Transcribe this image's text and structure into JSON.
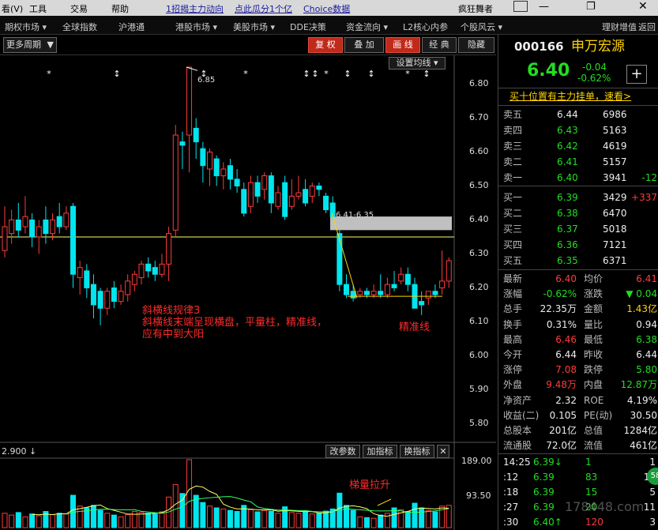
{
  "menubar": {
    "items": [
      "看(V)",
      "工具",
      "交易",
      "帮助",
      "1招揭主力动向",
      "点此瓜分1个亿",
      "Choice数据",
      "疯狂舞者"
    ],
    "window_icons": [
      "mail-icon",
      "minimize-icon",
      "restore-icon",
      "close-icon"
    ]
  },
  "navbar": {
    "items": [
      "期权市场 ▾",
      "全球指数",
      "沪港通",
      "港股市场 ▾",
      "美股市场 ▾",
      "DDE决策",
      "资金流向 ▾",
      "L2核心内参",
      "个股风云 ▾",
      "理财增值",
      "返回"
    ]
  },
  "charttools": {
    "period": "更多周期",
    "fq": "复 权",
    "overlay": "叠 加",
    "line": "画 线",
    "classic": "经 典",
    "hide": "隐藏"
  },
  "chart": {
    "ma_setting": "设置均线",
    "high_label": "6.85",
    "range_label": "6.41-6.35",
    "price_ticks": [
      "6.80",
      "6.70",
      "6.60",
      "6.50",
      "6.40",
      "6.30",
      "6.20",
      "6.10",
      "6.00",
      "5.90",
      "5.80"
    ],
    "annotation_lines": [
      "斜横线规律3",
      "斜横线末端呈现横盘，平量柱，精准线，",
      "应有中到大阳"
    ],
    "precise_label": "精准线",
    "volume_label": "梯量拉升",
    "vol_ticks": [
      "189.00",
      "93.50"
    ],
    "vol_readout": "2.900",
    "vol_buttons": [
      "改参数",
      "加指标",
      "换指标"
    ],
    "candles": [
      {
        "o": 6.31,
        "c": 6.38,
        "h": 6.44,
        "l": 6.29
      },
      {
        "o": 6.36,
        "c": 6.4,
        "h": 6.43,
        "l": 6.33
      },
      {
        "o": 6.4,
        "c": 6.37,
        "h": 6.45,
        "l": 6.35
      },
      {
        "o": 6.38,
        "c": 6.41,
        "h": 6.47,
        "l": 6.36
      },
      {
        "o": 6.4,
        "c": 6.35,
        "h": 6.42,
        "l": 6.32
      },
      {
        "o": 6.35,
        "c": 6.38,
        "h": 6.4,
        "l": 6.3
      },
      {
        "o": 6.4,
        "c": 6.36,
        "h": 6.44,
        "l": 6.33
      },
      {
        "o": 6.36,
        "c": 6.4,
        "h": 6.42,
        "l": 6.34
      },
      {
        "o": 6.41,
        "c": 6.38,
        "h": 6.45,
        "l": 6.36
      },
      {
        "o": 6.38,
        "c": 6.42,
        "h": 6.44,
        "l": 6.37
      },
      {
        "o": 6.44,
        "c": 6.24,
        "h": 6.45,
        "l": 6.2
      },
      {
        "o": 6.23,
        "c": 6.26,
        "h": 6.28,
        "l": 6.18
      },
      {
        "o": 6.25,
        "c": 6.2,
        "h": 6.27,
        "l": 6.17
      },
      {
        "o": 6.21,
        "c": 6.15,
        "h": 6.24,
        "l": 6.11
      },
      {
        "o": 6.19,
        "c": 6.14,
        "h": 6.2,
        "l": 6.09
      },
      {
        "o": 6.14,
        "c": 6.19,
        "h": 6.2,
        "l": 6.12
      },
      {
        "o": 6.2,
        "c": 6.16,
        "h": 6.22,
        "l": 6.14
      },
      {
        "o": 6.16,
        "c": 6.19,
        "h": 6.21,
        "l": 6.15
      },
      {
        "o": 6.18,
        "c": 6.22,
        "h": 6.24,
        "l": 6.16
      },
      {
        "o": 6.21,
        "c": 6.24,
        "h": 6.25,
        "l": 6.19
      },
      {
        "o": 6.23,
        "c": 6.27,
        "h": 6.28,
        "l": 6.21
      },
      {
        "o": 6.27,
        "c": 6.25,
        "h": 6.29,
        "l": 6.23
      },
      {
        "o": 6.26,
        "c": 6.24,
        "h": 6.28,
        "l": 6.22
      },
      {
        "o": 6.24,
        "c": 6.27,
        "h": 6.3,
        "l": 6.23
      },
      {
        "o": 6.27,
        "c": 6.36,
        "h": 6.38,
        "l": 6.22
      },
      {
        "o": 6.37,
        "c": 6.65,
        "h": 6.68,
        "l": 6.35
      },
      {
        "o": 6.63,
        "c": 6.62,
        "h": 6.66,
        "l": 6.55
      },
      {
        "o": 6.65,
        "c": 6.85,
        "h": 6.85,
        "l": 6.54
      },
      {
        "o": 6.67,
        "c": 6.63,
        "h": 6.7,
        "l": 6.58
      },
      {
        "o": 6.61,
        "c": 6.56,
        "h": 6.63,
        "l": 6.51
      },
      {
        "o": 6.55,
        "c": 6.6,
        "h": 6.61,
        "l": 6.5
      },
      {
        "o": 6.58,
        "c": 6.53,
        "h": 6.59,
        "l": 6.5
      },
      {
        "o": 6.53,
        "c": 6.55,
        "h": 6.57,
        "l": 6.49
      },
      {
        "o": 6.56,
        "c": 6.52,
        "h": 6.58,
        "l": 6.49
      },
      {
        "o": 6.52,
        "c": 6.5,
        "h": 6.55,
        "l": 6.48
      },
      {
        "o": 6.49,
        "c": 6.42,
        "h": 6.51,
        "l": 6.41
      },
      {
        "o": 6.44,
        "c": 6.51,
        "h": 6.53,
        "l": 6.42
      },
      {
        "o": 6.51,
        "c": 6.47,
        "h": 6.53,
        "l": 6.45
      },
      {
        "o": 6.49,
        "c": 6.53,
        "h": 6.54,
        "l": 6.46
      },
      {
        "o": 6.53,
        "c": 6.45,
        "h": 6.54,
        "l": 6.42
      },
      {
        "o": 6.44,
        "c": 6.48,
        "h": 6.5,
        "l": 6.43
      },
      {
        "o": 6.51,
        "c": 6.41,
        "h": 6.53,
        "l": 6.4
      },
      {
        "o": 6.44,
        "c": 6.47,
        "h": 6.52,
        "l": 6.43
      },
      {
        "o": 6.47,
        "c": 6.48,
        "h": 6.53,
        "l": 6.46
      },
      {
        "o": 6.49,
        "c": 6.45,
        "h": 6.52,
        "l": 6.44
      },
      {
        "o": 6.47,
        "c": 6.5,
        "h": 6.51,
        "l": 6.45
      },
      {
        "o": 6.5,
        "c": 6.49,
        "h": 6.51,
        "l": 6.47
      },
      {
        "o": 6.47,
        "c": 6.43,
        "h": 6.48,
        "l": 6.42
      },
      {
        "o": 6.45,
        "c": 6.41,
        "h": 6.47,
        "l": 6.4
      },
      {
        "o": 6.36,
        "c": 6.21,
        "h": 6.37,
        "l": 6.19
      },
      {
        "o": 6.21,
        "c": 6.18,
        "h": 6.24,
        "l": 6.17
      },
      {
        "o": 6.19,
        "c": 6.17,
        "h": 6.21,
        "l": 6.16
      },
      {
        "o": 6.18,
        "c": 6.19,
        "h": 6.2,
        "l": 6.17
      },
      {
        "o": 6.19,
        "c": 6.18,
        "h": 6.2,
        "l": 6.17
      },
      {
        "o": 6.18,
        "c": 6.19,
        "h": 6.21,
        "l": 6.17
      },
      {
        "o": 6.19,
        "c": 6.18,
        "h": 6.24,
        "l": 6.17
      },
      {
        "o": 6.18,
        "c": 6.21,
        "h": 6.23,
        "l": 6.17
      },
      {
        "o": 6.21,
        "c": 6.2,
        "h": 6.25,
        "l": 6.19
      },
      {
        "o": 6.22,
        "c": 6.24,
        "h": 6.26,
        "l": 6.21
      },
      {
        "o": 6.24,
        "c": 6.21,
        "h": 6.26,
        "l": 6.19
      },
      {
        "o": 6.21,
        "c": 6.14,
        "h": 6.23,
        "l": 6.14
      },
      {
        "o": 6.16,
        "c": 6.15,
        "h": 6.19,
        "l": 6.12
      },
      {
        "o": 6.17,
        "c": 6.19,
        "h": 6.19,
        "l": 6.15
      },
      {
        "o": 6.19,
        "c": 6.18,
        "h": 6.21,
        "l": 6.17
      },
      {
        "o": 6.2,
        "c": 6.22,
        "h": 6.31,
        "l": 6.18
      },
      {
        "o": 6.22,
        "c": 6.28,
        "h": 6.29,
        "l": 6.2
      }
    ],
    "volumes": [
      40,
      35,
      42,
      30,
      38,
      33,
      45,
      36,
      40,
      38,
      90,
      60,
      55,
      62,
      48,
      40,
      35,
      30,
      36,
      45,
      42,
      40,
      38,
      44,
      85,
      120,
      95,
      189,
      90,
      70,
      60,
      55,
      52,
      48,
      45,
      62,
      50,
      44,
      48,
      46,
      40,
      58,
      42,
      40,
      44,
      38,
      40,
      46,
      52,
      96,
      62,
      48,
      30,
      28,
      26,
      35,
      40,
      55,
      50,
      45,
      68,
      55,
      48,
      44,
      60,
      62
    ]
  },
  "quote": {
    "code": "000166",
    "name": "申万宏源",
    "price": "6.40",
    "change": "-0.04",
    "pct": "-0.62%",
    "ad": "买十位置有主力挂单，速看>",
    "sell": [
      {
        "label": "卖五",
        "price": "6.44",
        "vol": "6986",
        "chg": ""
      },
      {
        "label": "卖四",
        "price": "6.43",
        "vol": "5163",
        "chg": ""
      },
      {
        "label": "卖三",
        "price": "6.42",
        "vol": "4619",
        "chg": ""
      },
      {
        "label": "卖二",
        "price": "6.41",
        "vol": "5157",
        "chg": ""
      },
      {
        "label": "卖一",
        "price": "6.40",
        "vol": "3941",
        "chg": "-12"
      }
    ],
    "buy": [
      {
        "label": "买一",
        "price": "6.39",
        "vol": "3429",
        "chg": "+337"
      },
      {
        "label": "买二",
        "price": "6.38",
        "vol": "6470",
        "chg": ""
      },
      {
        "label": "买三",
        "price": "6.37",
        "vol": "5018",
        "chg": ""
      },
      {
        "label": "买四",
        "price": "6.36",
        "vol": "7121",
        "chg": ""
      },
      {
        "label": "买五",
        "price": "6.35",
        "vol": "6371",
        "chg": ""
      }
    ],
    "stats": [
      {
        "l1": "最新",
        "v1": "6.40",
        "c1": "red",
        "l2": "均价",
        "v2": "6.41",
        "c2": "red"
      },
      {
        "l1": "涨幅",
        "v1": "-0.62%",
        "c1": "green",
        "l2": "涨跌",
        "v2": "▼ 0.04",
        "c2": "green"
      },
      {
        "l1": "总手",
        "v1": "22.35万",
        "c1": "white",
        "l2": "金额",
        "v2": "1.43亿",
        "c2": "yellow"
      },
      {
        "l1": "换手",
        "v1": "0.31%",
        "c1": "white",
        "l2": "量比",
        "v2": "0.94",
        "c2": "white"
      },
      {
        "l1": "最高",
        "v1": "6.46",
        "c1": "red",
        "l2": "最低",
        "v2": "6.38",
        "c2": "green"
      },
      {
        "l1": "今开",
        "v1": "6.44",
        "c1": "white",
        "l2": "昨收",
        "v2": "6.44",
        "c2": "white"
      },
      {
        "l1": "涨停",
        "v1": "7.08",
        "c1": "red",
        "l2": "跌停",
        "v2": "5.80",
        "c2": "green"
      },
      {
        "l1": "外盘",
        "v1": "9.48万",
        "c1": "red",
        "l2": "内盘",
        "v2": "12.87万",
        "c2": "green"
      },
      {
        "l1": "净资产",
        "v1": "2.32",
        "c1": "white",
        "l2": "ROE",
        "v2": "4.19%",
        "c2": "white"
      },
      {
        "l1": "收益(二)",
        "v1": "0.105",
        "c1": "white",
        "l2": "PE(动)",
        "v2": "30.50",
        "c2": "white"
      },
      {
        "l1": "总股本",
        "v1": "201亿",
        "c1": "white",
        "l2": "总值",
        "v2": "1284亿",
        "c2": "white"
      },
      {
        "l1": "流通股",
        "v1": "72.0亿",
        "c1": "white",
        "l2": "流值",
        "v2": "461亿",
        "c2": "white"
      }
    ],
    "ticks": [
      {
        "time": "14:25",
        "price": "6.39↓",
        "vol": "1",
        "n": "1"
      },
      {
        "time": ":12",
        "price": "6.39",
        "vol": "83",
        "n": "15"
      },
      {
        "time": ":18",
        "price": "6.39",
        "vol": "15",
        "n": "5"
      },
      {
        "time": ":27",
        "price": "6.39",
        "vol": "20",
        "n": "11"
      },
      {
        "time": ":30",
        "price": "6.40↑",
        "vol": "120",
        "n": "3"
      }
    ],
    "watermark": "178448.com"
  },
  "colors": {
    "up": "#ff3b3b",
    "down": "#00e5ee",
    "ma": "#ffffff",
    "yellow": "#ffd400"
  }
}
